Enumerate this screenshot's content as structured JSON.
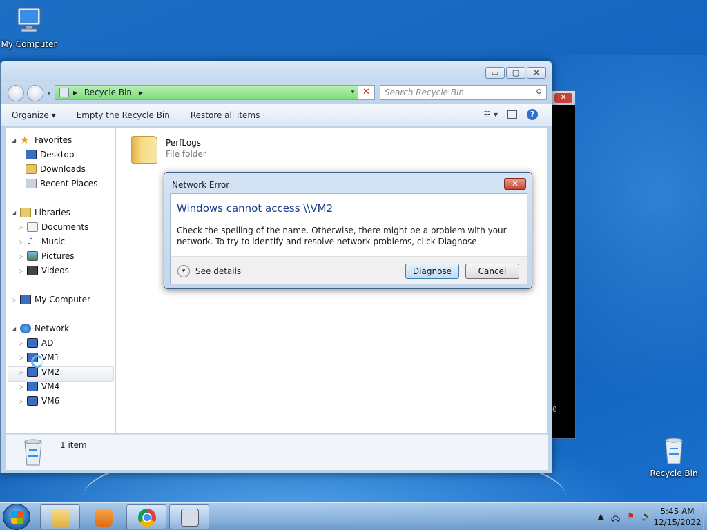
{
  "desktop": {
    "icons": [
      {
        "label": "My Computer"
      },
      {
        "label": "Recycle Bin"
      }
    ]
  },
  "explorer": {
    "title_buttons": {
      "minimize": "▭",
      "maximize": "▢",
      "close": "✕"
    },
    "address": {
      "path": "Recycle Bin",
      "separator": "▸"
    },
    "search": {
      "placeholder": "Search Recycle Bin"
    },
    "toolbar": {
      "organize": "Organize ▾",
      "empty": "Empty the Recycle Bin",
      "restore": "Restore all items"
    },
    "nav": {
      "favorites": "Favorites",
      "desktop": "Desktop",
      "downloads": "Downloads",
      "recent": "Recent Places",
      "libraries": "Libraries",
      "documents": "Documents",
      "music": "Music",
      "pictures": "Pictures",
      "videos": "Videos",
      "my_computer": "My Computer",
      "network": "Network",
      "ad": "AD",
      "vm1": "VM1",
      "vm2": "VM2",
      "vm4": "VM4",
      "vm6": "VM6"
    },
    "content": {
      "items": [
        {
          "name": "PerfLogs",
          "type": "File folder"
        }
      ]
    },
    "status": {
      "count": "1 item"
    }
  },
  "console": {
    "visible_text": "0"
  },
  "dialog": {
    "title": "Network Error",
    "heading": "Windows cannot access \\\\VM2",
    "message": "Check the spelling of the name. Otherwise, there might be a problem with your network. To try to identify and resolve network problems, click Diagnose.",
    "see_details": "See details",
    "diagnose": "Diagnose",
    "cancel": "Cancel"
  },
  "taskbar": {
    "time": "5:45 AM",
    "date": "12/15/2022"
  },
  "colors": {
    "accent": "#1a3e8a",
    "address_green": "#7fdc7a",
    "desktop_blue": "#1466c0"
  }
}
